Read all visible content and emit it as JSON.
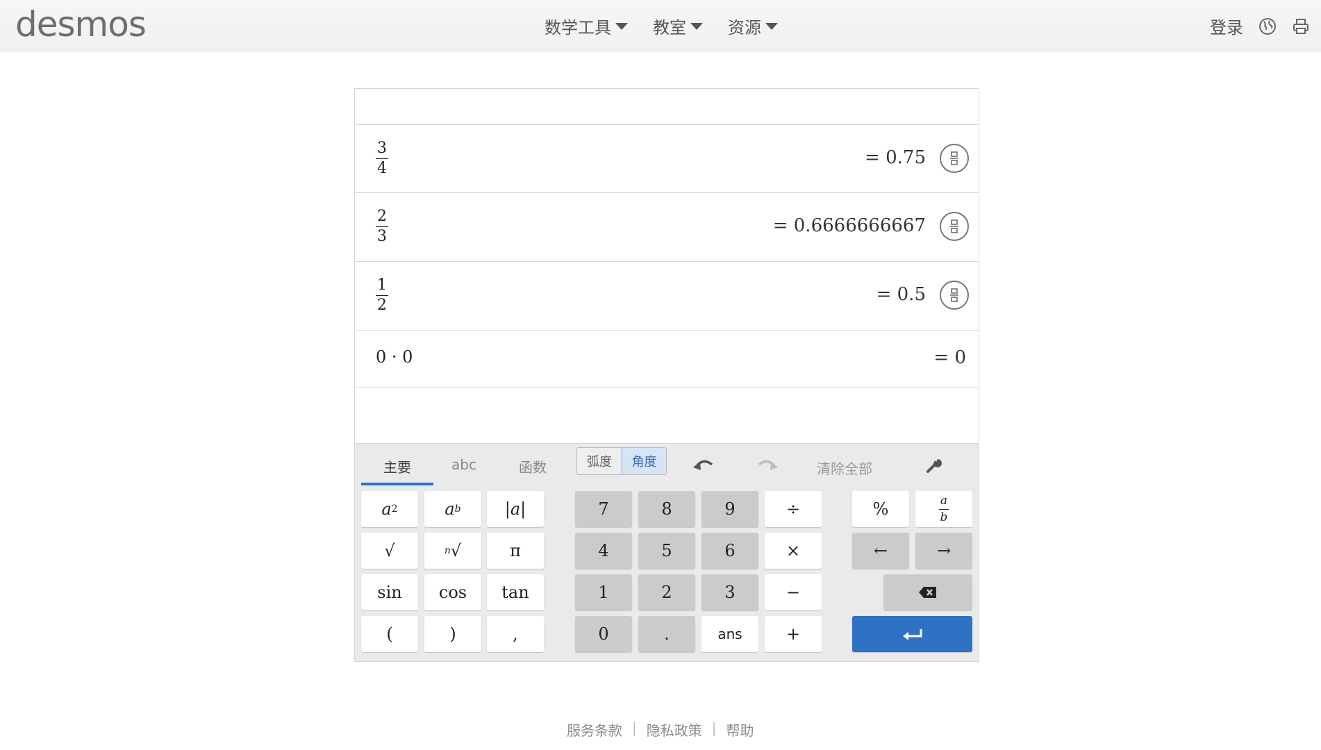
{
  "header": {
    "logo": "desmos",
    "nav": [
      {
        "label": "数学工具"
      },
      {
        "label": "教室"
      },
      {
        "label": "资源"
      }
    ],
    "login": "登录",
    "icons": [
      "globe-icon",
      "print-icon"
    ]
  },
  "calculator": {
    "rows": [
      {
        "numerator": "3",
        "denominator": "4",
        "result": "= 0.75",
        "toggle_icon": "fraction-toggle-icon"
      },
      {
        "numerator": "2",
        "denominator": "3",
        "result": "= 0.6666666667",
        "toggle_icon": "fraction-toggle-icon"
      },
      {
        "numerator": "1",
        "denominator": "2",
        "result": "= 0.5",
        "toggle_icon": "fraction-toggle-icon"
      }
    ],
    "dot_row": {
      "expression": "0 · 0",
      "result": "= 0"
    }
  },
  "keypad": {
    "tabs": [
      "主要",
      "abc",
      "函数"
    ],
    "active_tab": "主要",
    "angle_units": [
      "弧度",
      "角度"
    ],
    "active_unit": "角度",
    "clear_all": "清除全部",
    "icons": [
      "undo-icon",
      "redo-icon",
      "wrench-icon",
      "backspace-icon",
      "enter-icon"
    ],
    "left_keys": [
      [
        "a²",
        "aᵇ",
        "|a|"
      ],
      [
        "√",
        "ⁿ√",
        "π"
      ],
      [
        "sin",
        "cos",
        "tan"
      ],
      [
        "(",
        ")",
        ","
      ]
    ],
    "num_keys": [
      [
        "7",
        "8",
        "9",
        "÷"
      ],
      [
        "4",
        "5",
        "6",
        "×"
      ],
      [
        "1",
        "2",
        "3",
        "−"
      ],
      [
        "0",
        ".",
        "ans",
        "+"
      ]
    ],
    "right_keys": {
      "percent": "%",
      "fraction": {
        "numerator": "a",
        "denominator": "b"
      },
      "left_arrow": "←",
      "right_arrow": "→"
    },
    "accent_color": "#2f72c4"
  },
  "footer": {
    "links": [
      "服务条款",
      "隐私政策",
      "帮助"
    ],
    "separator": "|"
  }
}
